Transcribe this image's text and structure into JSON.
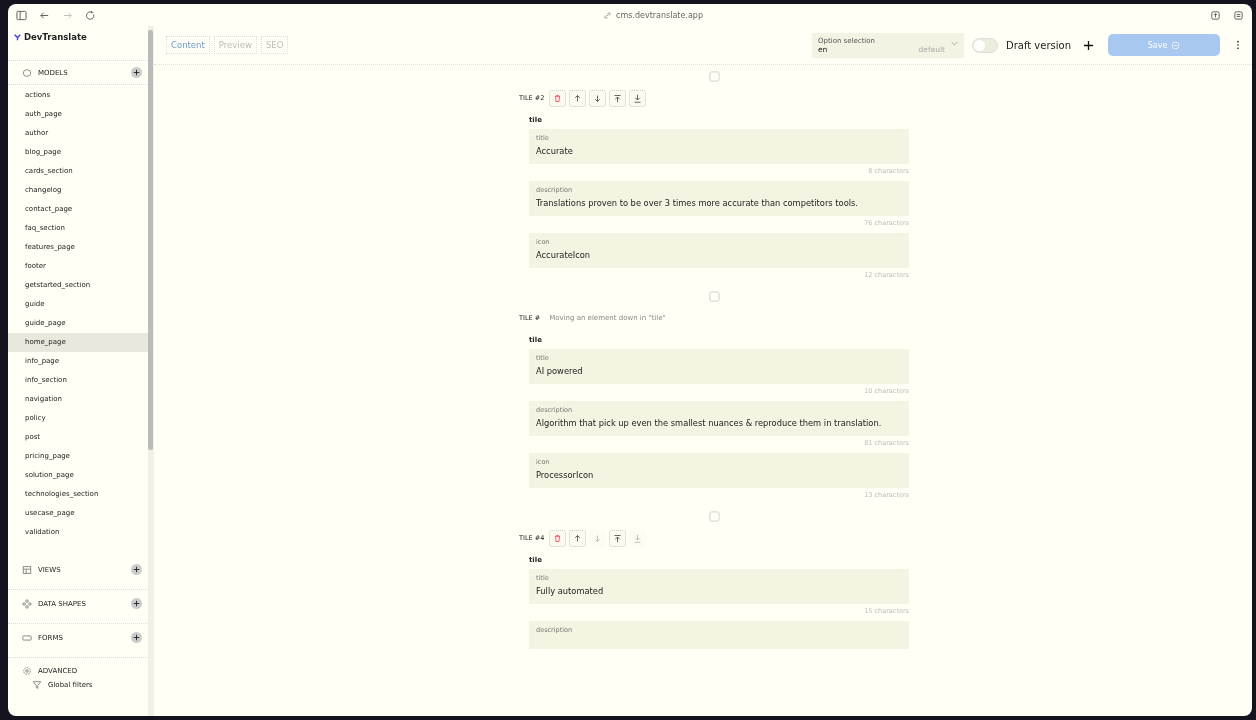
{
  "browser": {
    "url": "cms.devtranslate.app"
  },
  "sidebar": {
    "brand": "DevTranslate",
    "models": {
      "title": "MODELS",
      "items": [
        {
          "label": "actions",
          "selected": false
        },
        {
          "label": "auth_page",
          "selected": false
        },
        {
          "label": "author",
          "selected": false
        },
        {
          "label": "blog_page",
          "selected": false
        },
        {
          "label": "cards_section",
          "selected": false
        },
        {
          "label": "changelog",
          "selected": false
        },
        {
          "label": "contact_page",
          "selected": false
        },
        {
          "label": "faq_section",
          "selected": false
        },
        {
          "label": "features_page",
          "selected": false
        },
        {
          "label": "footer",
          "selected": false
        },
        {
          "label": "getstarted_section",
          "selected": false
        },
        {
          "label": "guide",
          "selected": false
        },
        {
          "label": "guide_page",
          "selected": false
        },
        {
          "label": "home_page",
          "selected": true
        },
        {
          "label": "info_page",
          "selected": false
        },
        {
          "label": "info_section",
          "selected": false
        },
        {
          "label": "navigation",
          "selected": false
        },
        {
          "label": "policy",
          "selected": false
        },
        {
          "label": "post",
          "selected": false
        },
        {
          "label": "pricing_page",
          "selected": false
        },
        {
          "label": "solution_page",
          "selected": false
        },
        {
          "label": "technologies_section",
          "selected": false
        },
        {
          "label": "usecase_page",
          "selected": false
        },
        {
          "label": "validation",
          "selected": false
        }
      ]
    },
    "sections": [
      {
        "kind": "views",
        "title": "VIEWS"
      },
      {
        "kind": "shapes",
        "title": "DATA SHAPES"
      },
      {
        "kind": "forms",
        "title": "FORMS"
      }
    ],
    "advanced": {
      "title": "ADVANCED",
      "items": [
        "Global filters"
      ]
    }
  },
  "header": {
    "tabs": [
      {
        "label": "Content",
        "selected": true
      },
      {
        "label": "Preview",
        "selected": false
      },
      {
        "label": "SEO",
        "selected": false
      }
    ],
    "option": {
      "label": "Option selection",
      "value": "en",
      "hint": "default"
    },
    "draft": {
      "label": "Draft version",
      "on": false
    },
    "save": {
      "label": "Save",
      "disabled": true
    }
  },
  "tiles": [
    {
      "label": "TILE #2",
      "group": "tile",
      "actions": [
        {
          "kind": "delete",
          "disabled": false
        },
        {
          "kind": "up",
          "disabled": false
        },
        {
          "kind": "down",
          "disabled": false
        },
        {
          "kind": "top",
          "disabled": false
        },
        {
          "kind": "bottom",
          "disabled": false
        }
      ],
      "fields": [
        {
          "label": "title",
          "value": "Accurate",
          "count": "8 characters"
        },
        {
          "label": "description",
          "value": "Translations proven to be over 3 times more accurate than competitors tools.",
          "count": "76 characters"
        },
        {
          "label": "icon",
          "value": "AccurateIcon",
          "count": "12 characters"
        }
      ]
    },
    {
      "label": "TILE #",
      "tooltip": "Moving an element down in \"tile\"",
      "group": "tile",
      "fields": [
        {
          "label": "title",
          "value": "AI powered",
          "count": "10 characters"
        },
        {
          "label": "description",
          "value": "Algorithm that pick up even the smallest nuances & reproduce them in translation.",
          "count": "81 characters"
        },
        {
          "label": "icon",
          "value": "ProcessorIcon",
          "count": "13 characters"
        }
      ]
    },
    {
      "label": "TILE #4",
      "group": "tile",
      "actions": [
        {
          "kind": "delete",
          "disabled": false
        },
        {
          "kind": "up",
          "disabled": false
        },
        {
          "kind": "down",
          "disabled": true
        },
        {
          "kind": "top",
          "disabled": false
        },
        {
          "kind": "bottom",
          "disabled": true
        }
      ],
      "fields": [
        {
          "label": "title",
          "value": "Fully automated",
          "count": "15 characters"
        },
        {
          "label": "description"
        }
      ]
    }
  ]
}
